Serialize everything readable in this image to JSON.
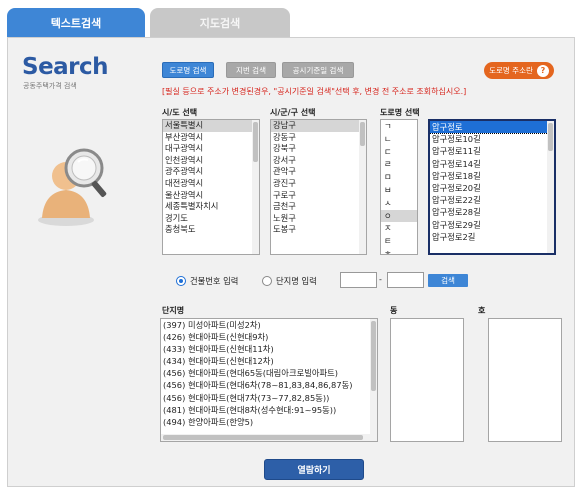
{
  "tabs": {
    "text_search": "텍스트검색",
    "map_search": "지도검색"
  },
  "logo": {
    "title": "Search",
    "subtitle": "공동주택가격 검색"
  },
  "search_type_buttons": {
    "road": "도로명 검색",
    "jibun": "지번 검색",
    "official": "공시기준일 검색"
  },
  "road_address_button": {
    "label": "도로명 주소란",
    "icon": "?"
  },
  "notice": "[필실 등으로 주소가 변경된경우, \"공시기준일 검색\"선택 후, 변경 전 주소로 조회하십시오.]",
  "labels": {
    "sido": "시/도 선택",
    "sigungu": "시/군/구 선택",
    "road": "도로명 선택",
    "complex": "단지명",
    "dong": "동",
    "ho": "호"
  },
  "sido_list": [
    "서울특별시",
    "부산광역시",
    "대구광역시",
    "인천광역시",
    "광주광역시",
    "대전광역시",
    "울산광역시",
    "세종특별자치시",
    "경기도",
    "충청북도"
  ],
  "sigungu_list": [
    "강남구",
    "강동구",
    "강북구",
    "강서구",
    "관악구",
    "광진구",
    "구로구",
    "금천구",
    "노원구",
    "도봉구"
  ],
  "consonant_list": [
    "ㄱ",
    "ㄴ",
    "ㄷ",
    "ㄹ",
    "ㅁ",
    "ㅂ",
    "ㅅ",
    "ㅇ",
    "ㅈ",
    "ㅌ",
    "ㅎ"
  ],
  "road_list": [
    "압구정로",
    "압구정로10길",
    "압구정로11길",
    "압구정로14길",
    "압구정로18길",
    "압구정로20길",
    "압구정로22길",
    "압구정로28길",
    "압구정로29길",
    "압구정로2길"
  ],
  "input_mode": {
    "building": "건물번호 입력",
    "complex": "단지명 입력"
  },
  "search_button": "검색",
  "dash": "-",
  "complex_list": [
    "(397) 미성아파트(미성2차)",
    "(426) 현대아파트(신현대9차)",
    "(433) 현대아파트(신현대11차)",
    "(434) 현대아파트(신현대12차)",
    "(456) 현대아파트(현대65동(대림아크로빌아파트)",
    "(456) 현대아파트(현대6차(78~81,83,84,86,87동)",
    "(456) 현대아파트(현대7차(73~77,82,85동))",
    "(481) 현대아파트(현대8차(성수현대:91~95동))",
    "(494) 한양아파트(한양5)"
  ],
  "view_button": "열람하기"
}
